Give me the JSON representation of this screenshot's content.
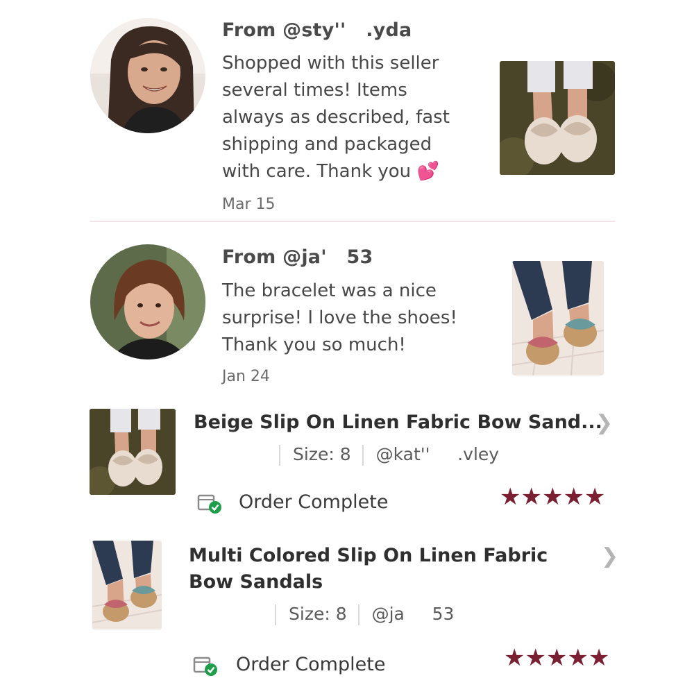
{
  "reviews": [
    {
      "from": "From @sty''   .yda",
      "text": "Shopped with this seller several times! Items always as described, fast shipping and packaged with care. Thank you",
      "emoji": "💕",
      "date": "Mar 15",
      "avatar_icon": "woman-smiling-avatar",
      "product_icon": "beige-bow-sandals-photo"
    },
    {
      "from": "From @ja'   53",
      "text": "The bracelet was a nice surprise! I love the shoes! Thank you so much!",
      "date": "Jan 24",
      "avatar_icon": "woman-portrait-avatar",
      "product_icon": "multicolor-bow-sandals-photo"
    }
  ],
  "orders": [
    {
      "title": "Beige Slip On Linen Fabric Bow Sand...",
      "size": "Size: 8",
      "seller": "@kat''     .vley",
      "status": "Order Complete",
      "stars": "★★★★★",
      "rating": 5
    },
    {
      "title_line1": "Multi Colored Slip On Linen Fabric",
      "title_line2": "Bow Sandals",
      "size": "Size: 8",
      "seller": "@ja     53",
      "status": "Order Complete",
      "stars": "★★★★★",
      "rating": 5
    }
  ],
  "colors": {
    "star": "#7b1f33",
    "check": "#1e9e4a",
    "divider": "#f3e3e6"
  }
}
